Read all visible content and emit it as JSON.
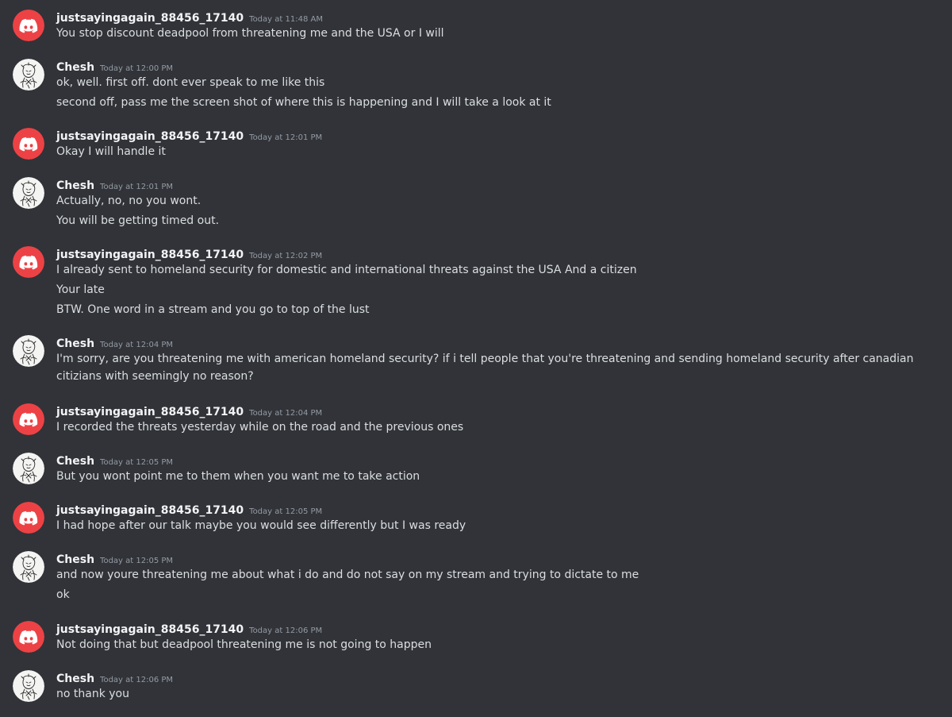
{
  "colors": {
    "background": "#313338",
    "discord_red": "#ed4245",
    "username": "#f2f3f5",
    "timestamp": "#949ba4",
    "text": "#dbdee1"
  },
  "messages": [
    {
      "author": "justsayingagain_88456_17140",
      "avatar": "discord-logo-icon",
      "time": "Today at 11:48 AM",
      "lines": [
        "You stop discount deadpool from threatening me and the USA or I will"
      ]
    },
    {
      "author": "Chesh",
      "avatar": "sketch-character-icon",
      "time": "Today at 12:00 PM",
      "lines": [
        "ok, well. first off. dont ever speak to me like this",
        "second off, pass me the screen shot of where this is happening and I will take a look at it"
      ]
    },
    {
      "author": "justsayingagain_88456_17140",
      "avatar": "discord-logo-icon",
      "time": "Today at 12:01 PM",
      "lines": [
        "Okay I will handle it"
      ]
    },
    {
      "author": "Chesh",
      "avatar": "sketch-character-icon",
      "time": "Today at 12:01 PM",
      "lines": [
        "Actually, no, no you wont.",
        "You will be getting timed out."
      ]
    },
    {
      "author": "justsayingagain_88456_17140",
      "avatar": "discord-logo-icon",
      "time": "Today at 12:02 PM",
      "lines": [
        "I already sent to homeland security for domestic and international threats against the USA And a citizen",
        "Your late",
        "BTW. One word in a stream and you go to top of the lust"
      ]
    },
    {
      "author": "Chesh",
      "avatar": "sketch-character-icon",
      "time": "Today at 12:04 PM",
      "lines": [
        "I'm sorry, are you threatening me with american homeland security? if i tell people that you're threatening and sending homeland security after canadian citizians with seemingly no reason?"
      ]
    },
    {
      "author": "justsayingagain_88456_17140",
      "avatar": "discord-logo-icon",
      "time": "Today at 12:04 PM",
      "lines": [
        "I recorded the threats yesterday while on the road and the previous ones"
      ]
    },
    {
      "author": "Chesh",
      "avatar": "sketch-character-icon",
      "time": "Today at 12:05 PM",
      "lines": [
        "But you wont point me to them when you want me to take action"
      ]
    },
    {
      "author": "justsayingagain_88456_17140",
      "avatar": "discord-logo-icon",
      "time": "Today at 12:05 PM",
      "lines": [
        "I had hope after our talk maybe you would see differently but I was ready"
      ]
    },
    {
      "author": "Chesh",
      "avatar": "sketch-character-icon",
      "time": "Today at 12:05 PM",
      "lines": [
        "and now youre threatening me about what i do and do not say on my stream and trying to dictate to me",
        "ok"
      ]
    },
    {
      "author": "justsayingagain_88456_17140",
      "avatar": "discord-logo-icon",
      "time": "Today at 12:06 PM",
      "lines": [
        "Not doing that but deadpool threatening me is not going to happen"
      ]
    },
    {
      "author": "Chesh",
      "avatar": "sketch-character-icon",
      "time": "Today at 12:06 PM",
      "lines": [
        "no thank you"
      ]
    }
  ]
}
